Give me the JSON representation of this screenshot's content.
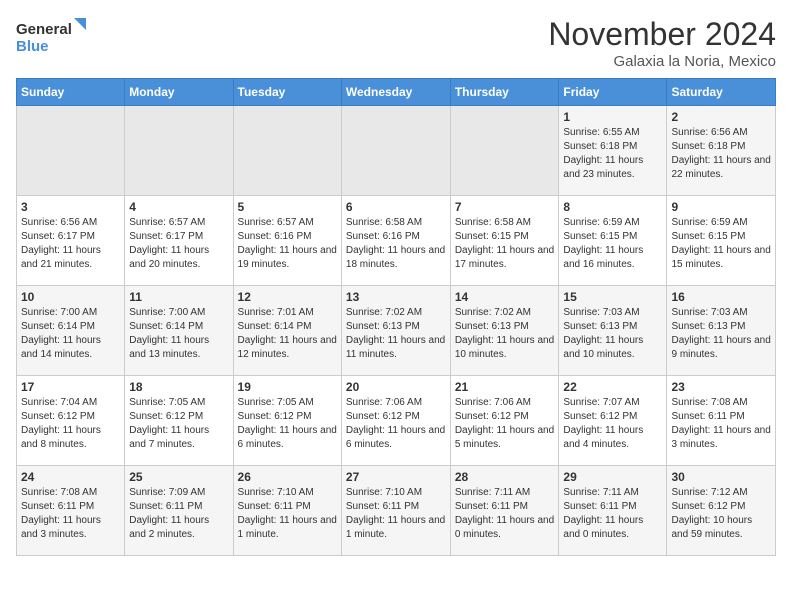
{
  "header": {
    "logo_line1": "General",
    "logo_line2": "Blue",
    "month": "November 2024",
    "location": "Galaxia la Noria, Mexico"
  },
  "columns": [
    "Sunday",
    "Monday",
    "Tuesday",
    "Wednesday",
    "Thursday",
    "Friday",
    "Saturday"
  ],
  "weeks": [
    [
      {
        "day": "",
        "sunrise": "",
        "sunset": "",
        "daylight": ""
      },
      {
        "day": "",
        "sunrise": "",
        "sunset": "",
        "daylight": ""
      },
      {
        "day": "",
        "sunrise": "",
        "sunset": "",
        "daylight": ""
      },
      {
        "day": "",
        "sunrise": "",
        "sunset": "",
        "daylight": ""
      },
      {
        "day": "",
        "sunrise": "",
        "sunset": "",
        "daylight": ""
      },
      {
        "day": "1",
        "sunrise": "Sunrise: 6:55 AM",
        "sunset": "Sunset: 6:18 PM",
        "daylight": "Daylight: 11 hours and 23 minutes."
      },
      {
        "day": "2",
        "sunrise": "Sunrise: 6:56 AM",
        "sunset": "Sunset: 6:18 PM",
        "daylight": "Daylight: 11 hours and 22 minutes."
      }
    ],
    [
      {
        "day": "3",
        "sunrise": "Sunrise: 6:56 AM",
        "sunset": "Sunset: 6:17 PM",
        "daylight": "Daylight: 11 hours and 21 minutes."
      },
      {
        "day": "4",
        "sunrise": "Sunrise: 6:57 AM",
        "sunset": "Sunset: 6:17 PM",
        "daylight": "Daylight: 11 hours and 20 minutes."
      },
      {
        "day": "5",
        "sunrise": "Sunrise: 6:57 AM",
        "sunset": "Sunset: 6:16 PM",
        "daylight": "Daylight: 11 hours and 19 minutes."
      },
      {
        "day": "6",
        "sunrise": "Sunrise: 6:58 AM",
        "sunset": "Sunset: 6:16 PM",
        "daylight": "Daylight: 11 hours and 18 minutes."
      },
      {
        "day": "7",
        "sunrise": "Sunrise: 6:58 AM",
        "sunset": "Sunset: 6:15 PM",
        "daylight": "Daylight: 11 hours and 17 minutes."
      },
      {
        "day": "8",
        "sunrise": "Sunrise: 6:59 AM",
        "sunset": "Sunset: 6:15 PM",
        "daylight": "Daylight: 11 hours and 16 minutes."
      },
      {
        "day": "9",
        "sunrise": "Sunrise: 6:59 AM",
        "sunset": "Sunset: 6:15 PM",
        "daylight": "Daylight: 11 hours and 15 minutes."
      }
    ],
    [
      {
        "day": "10",
        "sunrise": "Sunrise: 7:00 AM",
        "sunset": "Sunset: 6:14 PM",
        "daylight": "Daylight: 11 hours and 14 minutes."
      },
      {
        "day": "11",
        "sunrise": "Sunrise: 7:00 AM",
        "sunset": "Sunset: 6:14 PM",
        "daylight": "Daylight: 11 hours and 13 minutes."
      },
      {
        "day": "12",
        "sunrise": "Sunrise: 7:01 AM",
        "sunset": "Sunset: 6:14 PM",
        "daylight": "Daylight: 11 hours and 12 minutes."
      },
      {
        "day": "13",
        "sunrise": "Sunrise: 7:02 AM",
        "sunset": "Sunset: 6:13 PM",
        "daylight": "Daylight: 11 hours and 11 minutes."
      },
      {
        "day": "14",
        "sunrise": "Sunrise: 7:02 AM",
        "sunset": "Sunset: 6:13 PM",
        "daylight": "Daylight: 11 hours and 10 minutes."
      },
      {
        "day": "15",
        "sunrise": "Sunrise: 7:03 AM",
        "sunset": "Sunset: 6:13 PM",
        "daylight": "Daylight: 11 hours and 10 minutes."
      },
      {
        "day": "16",
        "sunrise": "Sunrise: 7:03 AM",
        "sunset": "Sunset: 6:13 PM",
        "daylight": "Daylight: 11 hours and 9 minutes."
      }
    ],
    [
      {
        "day": "17",
        "sunrise": "Sunrise: 7:04 AM",
        "sunset": "Sunset: 6:12 PM",
        "daylight": "Daylight: 11 hours and 8 minutes."
      },
      {
        "day": "18",
        "sunrise": "Sunrise: 7:05 AM",
        "sunset": "Sunset: 6:12 PM",
        "daylight": "Daylight: 11 hours and 7 minutes."
      },
      {
        "day": "19",
        "sunrise": "Sunrise: 7:05 AM",
        "sunset": "Sunset: 6:12 PM",
        "daylight": "Daylight: 11 hours and 6 minutes."
      },
      {
        "day": "20",
        "sunrise": "Sunrise: 7:06 AM",
        "sunset": "Sunset: 6:12 PM",
        "daylight": "Daylight: 11 hours and 6 minutes."
      },
      {
        "day": "21",
        "sunrise": "Sunrise: 7:06 AM",
        "sunset": "Sunset: 6:12 PM",
        "daylight": "Daylight: 11 hours and 5 minutes."
      },
      {
        "day": "22",
        "sunrise": "Sunrise: 7:07 AM",
        "sunset": "Sunset: 6:12 PM",
        "daylight": "Daylight: 11 hours and 4 minutes."
      },
      {
        "day": "23",
        "sunrise": "Sunrise: 7:08 AM",
        "sunset": "Sunset: 6:11 PM",
        "daylight": "Daylight: 11 hours and 3 minutes."
      }
    ],
    [
      {
        "day": "24",
        "sunrise": "Sunrise: 7:08 AM",
        "sunset": "Sunset: 6:11 PM",
        "daylight": "Daylight: 11 hours and 3 minutes."
      },
      {
        "day": "25",
        "sunrise": "Sunrise: 7:09 AM",
        "sunset": "Sunset: 6:11 PM",
        "daylight": "Daylight: 11 hours and 2 minutes."
      },
      {
        "day": "26",
        "sunrise": "Sunrise: 7:10 AM",
        "sunset": "Sunset: 6:11 PM",
        "daylight": "Daylight: 11 hours and 1 minute."
      },
      {
        "day": "27",
        "sunrise": "Sunrise: 7:10 AM",
        "sunset": "Sunset: 6:11 PM",
        "daylight": "Daylight: 11 hours and 1 minute."
      },
      {
        "day": "28",
        "sunrise": "Sunrise: 7:11 AM",
        "sunset": "Sunset: 6:11 PM",
        "daylight": "Daylight: 11 hours and 0 minutes."
      },
      {
        "day": "29",
        "sunrise": "Sunrise: 7:11 AM",
        "sunset": "Sunset: 6:11 PM",
        "daylight": "Daylight: 11 hours and 0 minutes."
      },
      {
        "day": "30",
        "sunrise": "Sunrise: 7:12 AM",
        "sunset": "Sunset: 6:12 PM",
        "daylight": "Daylight: 10 hours and 59 minutes."
      }
    ]
  ]
}
